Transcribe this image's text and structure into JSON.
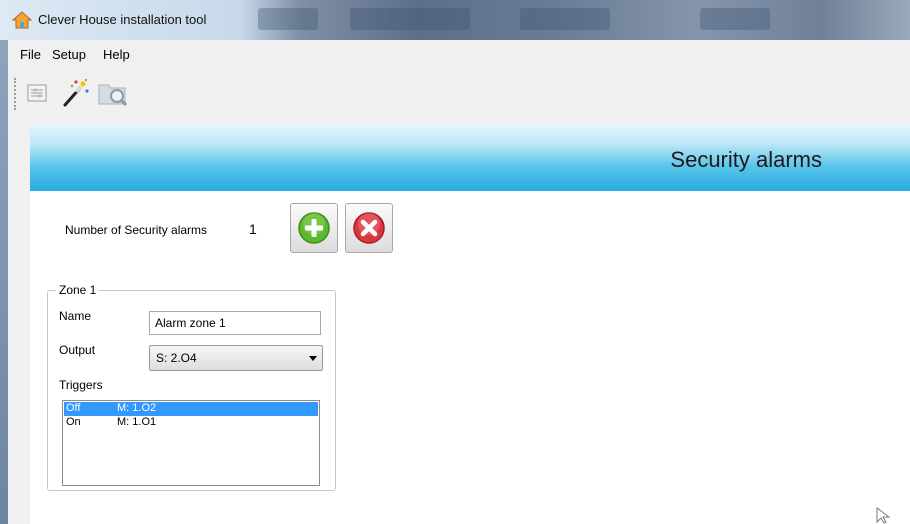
{
  "window": {
    "title": "Clever House installation tool",
    "icon": "house-icon"
  },
  "menu": {
    "file": "File",
    "setup": "Setup",
    "help": "Help"
  },
  "toolbar": {
    "buttons": [
      "settings-list-icon",
      "magic-wand-icon",
      "folder-search-icon"
    ]
  },
  "banner": {
    "title": "Security alarms"
  },
  "alarms": {
    "count_label": "Number of Security alarms",
    "count": "1",
    "add_icon": "plus-icon",
    "remove_icon": "remove-x-icon"
  },
  "zone": {
    "legend": "Zone 1",
    "name_label": "Name",
    "name_value": "Alarm zone 1",
    "output_label": "Output",
    "output_value": "S: 2.O4",
    "triggers_label": "Triggers",
    "triggers": [
      {
        "state": "Off",
        "input": "M: 1.O2",
        "selected": true
      },
      {
        "state": "On",
        "input": "M: 1.O1",
        "selected": false
      }
    ]
  },
  "colors": {
    "banner_blue": "#27acdf",
    "selection_blue": "#3399ff",
    "add_green": "#4caf2a",
    "remove_red": "#d9363e"
  }
}
